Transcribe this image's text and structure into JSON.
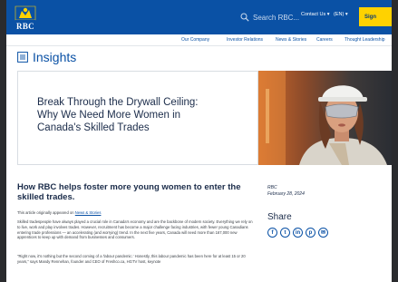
{
  "brand": {
    "logo_text": "RBC"
  },
  "header": {
    "search_placeholder": "Search RBC...",
    "contact_label": "Contact Us",
    "lang_label": "(EN)",
    "signin_label": "Sign"
  },
  "nav": {
    "items": [
      "Our Company",
      "Investor Relations",
      "News & Stories",
      "Careers",
      "Thought Leadership"
    ]
  },
  "section": {
    "title": "Insights"
  },
  "hero": {
    "title_line1": "Break Through the Drywall Ceiling:",
    "title_line2": "Why We Need More Women in",
    "title_line3": "Canada's Skilled Trades"
  },
  "article": {
    "heading": "How RBC helps foster more young women to enter the skilled trades.",
    "origin_prefix": "This article originally appeared on",
    "origin_link": "News & Stories",
    "para2": "Skilled tradespeople have always played a crucial role in Canada's economy and are the backbone of modern society. Everything we rely on to live, work and play involves trades. However, recruitment has become a major challenge facing industries, with fewer young Canadians entering trade professions — an accelerating (and worrying) trend. In the next five years, Canada will need more than 167,000 new apprentices to keep up with demand from businesses and consumers.",
    "para3": "\"Right now, it's nothing but the second coming of a 'labour pandemic.' Honestly, this labour pandemic has been here for at least 15 or 20 years,\" says Mandy Rennehan, founder and CEO of Freshco.ca, HGTV host, keynote"
  },
  "sidebar": {
    "author": "RBC",
    "date": "February 28, 2024",
    "share_label": "Share"
  },
  "share_icons": [
    {
      "name": "facebook-icon",
      "glyph": "f"
    },
    {
      "name": "twitter-icon",
      "glyph": "t"
    },
    {
      "name": "linkedin-icon",
      "glyph": "in"
    },
    {
      "name": "pinterest-icon",
      "glyph": "p"
    },
    {
      "name": "email-icon",
      "glyph": "✉"
    }
  ],
  "colors": {
    "brand_blue": "#0a51a5",
    "brand_yellow": "#ffd200",
    "heading_navy": "#1b2c4a"
  }
}
